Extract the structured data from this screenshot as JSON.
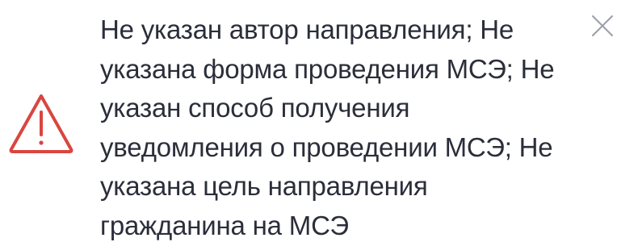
{
  "notification": {
    "type": "warning",
    "icon": "warning-triangle-icon",
    "accent_color": "#d9463f",
    "text_color": "#2b2e3a",
    "close_icon": "close-icon",
    "close_icon_color": "#9aa0aa",
    "message_lines": [
      "Не указан автор направления; Не",
      "указана форма проведения МСЭ; Не",
      "указан способ получения",
      "уведомления о проведении МСЭ; Не",
      "указана цель направления",
      "гражданина на МСЭ"
    ]
  }
}
